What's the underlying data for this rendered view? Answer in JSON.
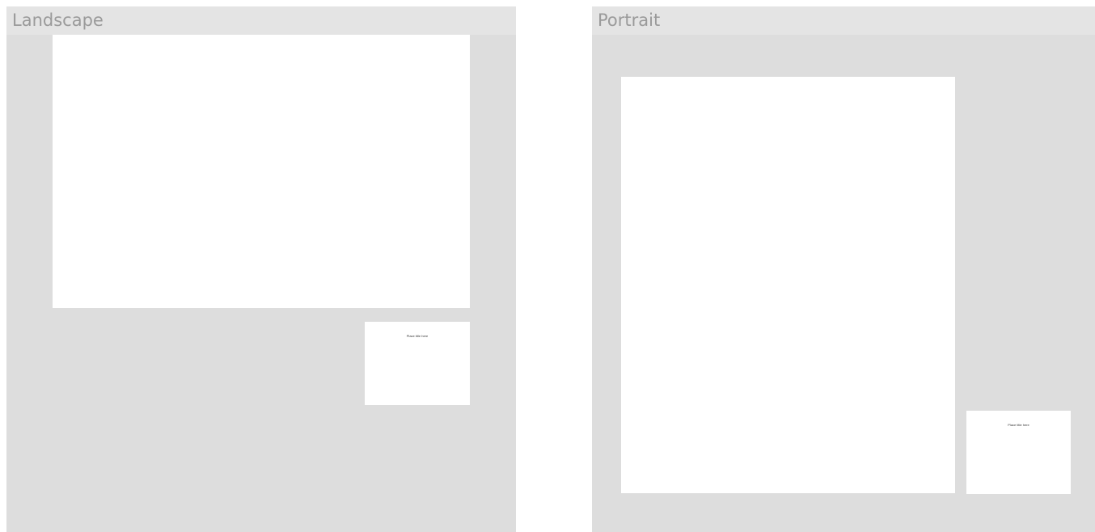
{
  "panels": {
    "landscape": {
      "title": "Landscape",
      "card_text": "Place title here"
    },
    "portrait": {
      "title": "Portrait",
      "card_text": "Place title here"
    }
  },
  "colors": {
    "panel_background": "#dddddd",
    "header_background": "#e4e4e4",
    "title_text": "#9a9a9a",
    "sheet": "#ffffff"
  }
}
